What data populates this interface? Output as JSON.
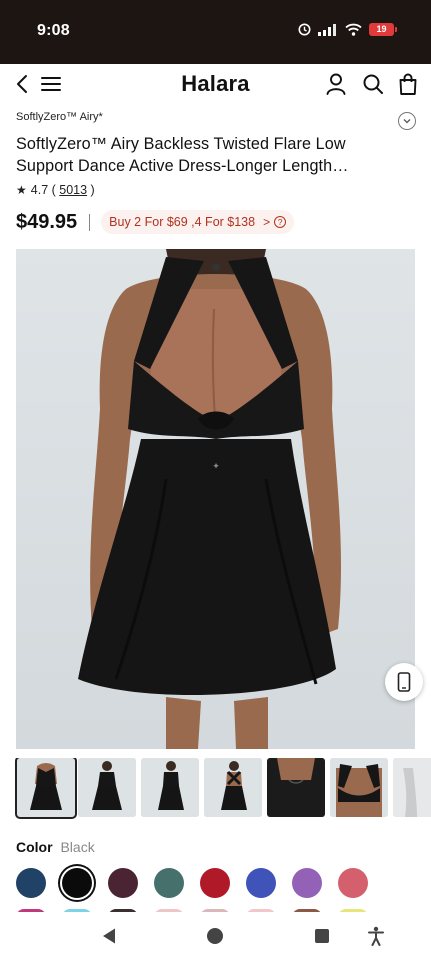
{
  "status": {
    "time": "9:08",
    "battery": "19"
  },
  "nav": {
    "brand": "Halara"
  },
  "product": {
    "brand_line": "SoftlyZero™ Airy*",
    "title": "SoftlyZero™ Airy Backless Twisted Flare Low Support Dance Active Dress-Longer Length…",
    "rating": "4.7",
    "review_count": "5013",
    "price": "$49.95",
    "promo": "Buy 2 For $69 ,4 For $138"
  },
  "icons": {
    "back": "back-arrow-icon",
    "menu": "hamburger-menu-icon",
    "account": "user-icon",
    "search": "search-icon",
    "bag": "shopping-bag-icon",
    "collapse": "chevron-down-icon",
    "star": "star-icon",
    "promo_arrow": "chevron-right-icon",
    "help": "question-icon",
    "float": "phone-icon",
    "system_back": "triangle-back-icon",
    "system_home": "circle-home-icon",
    "system_recents": "square-recents-icon",
    "accessibility": "accessibility-icon"
  },
  "color": {
    "label": "Color",
    "selected_name": "Black",
    "swatches": [
      "#1f4266",
      "#0b0b0b",
      "#4b2433",
      "#46706c",
      "#b01a28",
      "#3f53b8",
      "#9362b6",
      "#d4606d"
    ],
    "selected_index": 1,
    "peek_row": [
      "#c0397c",
      "#7fd3e6",
      "#3a3030",
      "#efc6c8",
      "#d9b7ba",
      "#f3c6cc",
      "#8b5a46",
      "#e6e67a"
    ]
  },
  "gallery": {
    "thumbnail_count": 7,
    "selected_index": 0
  },
  "colors": {
    "status_bar": "#1d1512",
    "promo_text": "#b3321f",
    "promo_bg": "#fbf1ee",
    "photo_bg": "#d9dfe2",
    "dress": "#151515"
  }
}
